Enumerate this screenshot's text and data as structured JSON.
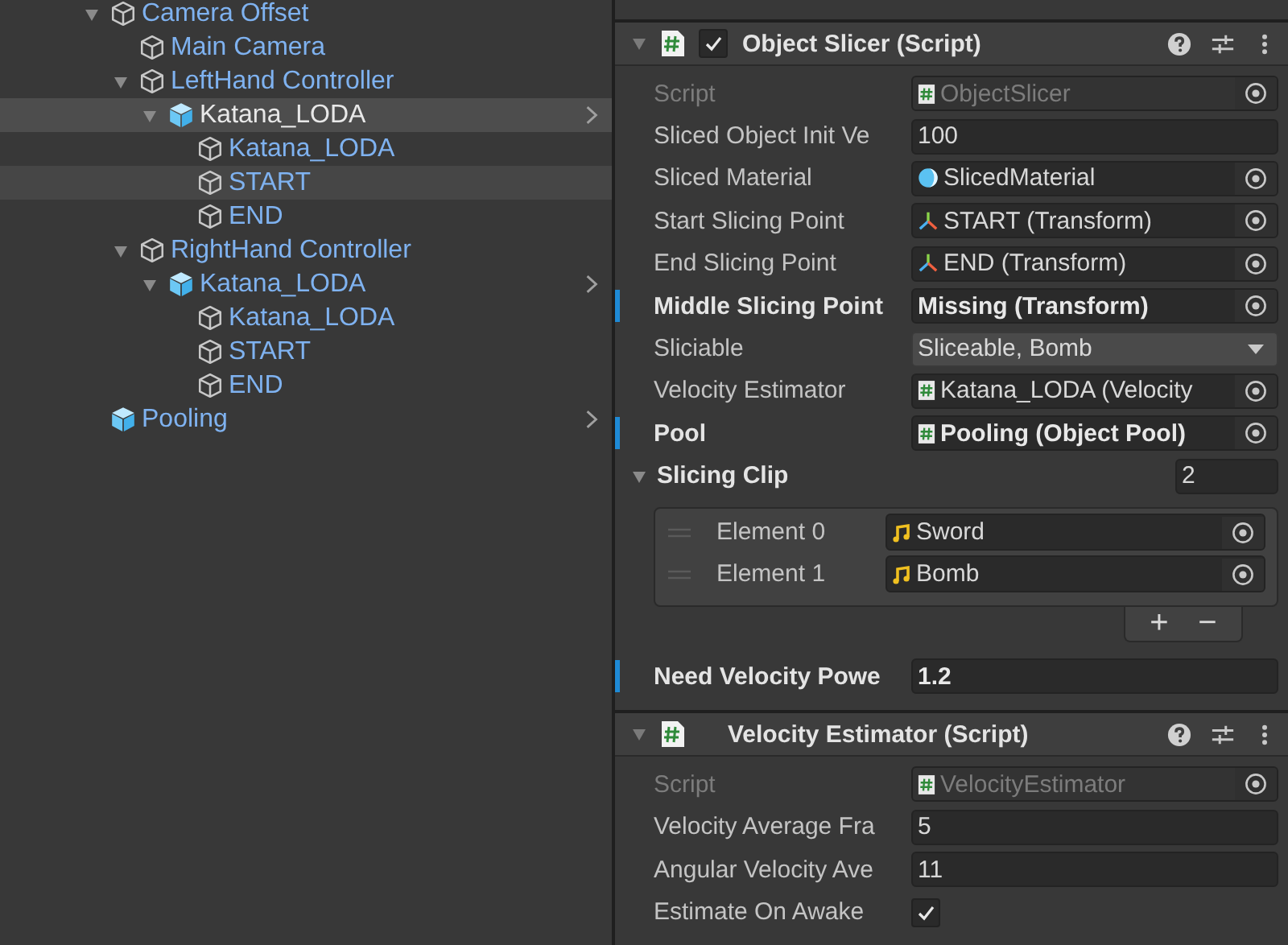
{
  "hierarchy": {
    "items": [
      {
        "name": "Camera Offset",
        "kind": "object",
        "expanded": true,
        "selected": false,
        "highlighted": false,
        "children": [
          {
            "name": "Main Camera",
            "kind": "object",
            "selected": false,
            "highlighted": false
          },
          {
            "name": "LeftHand Controller",
            "kind": "object",
            "expanded": true,
            "selected": false,
            "highlighted": false,
            "children": [
              {
                "name": "Katana_LODA",
                "kind": "prefab",
                "expanded": true,
                "selected": true,
                "highlighted": false,
                "children": [
                  {
                    "name": "Katana_LODA",
                    "kind": "object",
                    "selected": false,
                    "highlighted": false
                  },
                  {
                    "name": "START",
                    "kind": "object",
                    "selected": false,
                    "highlighted": true
                  },
                  {
                    "name": "END",
                    "kind": "object",
                    "selected": false,
                    "highlighted": false
                  }
                ]
              }
            ]
          },
          {
            "name": "RightHand Controller",
            "kind": "object",
            "expanded": true,
            "selected": false,
            "highlighted": false,
            "children": [
              {
                "name": "Katana_LODA",
                "kind": "prefab",
                "expanded": true,
                "selected": false,
                "highlighted": false,
                "children": [
                  {
                    "name": "Katana_LODA",
                    "kind": "object",
                    "selected": false,
                    "highlighted": false
                  },
                  {
                    "name": "START",
                    "kind": "object",
                    "selected": false,
                    "highlighted": false
                  },
                  {
                    "name": "END",
                    "kind": "object",
                    "selected": false,
                    "highlighted": false
                  }
                ]
              }
            ]
          }
        ]
      },
      {
        "name": "Pooling",
        "kind": "prefab",
        "selected": false,
        "highlighted": false
      }
    ]
  },
  "components": [
    {
      "title": "Object Slicer (Script)",
      "has_toggle": true,
      "enabled": true,
      "expanded": true,
      "fields": [
        {
          "kind": "script_ref",
          "label": "Script",
          "value": "ObjectSlicer",
          "disabled": true,
          "overridden": false
        },
        {
          "kind": "number",
          "label": "Sliced Object Init Ve",
          "value": "100",
          "disabled": false,
          "overridden": false
        },
        {
          "kind": "material_ref",
          "label": "Sliced Material",
          "value": "SlicedMaterial",
          "disabled": false,
          "overridden": false
        },
        {
          "kind": "transform_ref",
          "label": "Start Slicing Point",
          "value": "START (Transform)",
          "disabled": false,
          "overridden": false
        },
        {
          "kind": "transform_ref",
          "label": "End Slicing Point",
          "value": "END (Transform)",
          "disabled": false,
          "overridden": false
        },
        {
          "kind": "missing_ref",
          "label": "Middle Slicing Point",
          "value": "Missing (Transform)",
          "disabled": false,
          "overridden": true
        },
        {
          "kind": "dropdown",
          "label": "Sliciable",
          "value": "Sliceable, Bomb",
          "disabled": false,
          "overridden": false
        },
        {
          "kind": "script_ref",
          "label": "Velocity Estimator",
          "value": "Katana_LODA (Velocity",
          "disabled": false,
          "overridden": false
        },
        {
          "kind": "script_ref",
          "label": "Pool",
          "value": "Pooling (Object Pool)",
          "disabled": false,
          "overridden": true
        },
        {
          "kind": "array",
          "label": "Slicing Clip",
          "count": "2",
          "expanded": true,
          "add": "+",
          "remove": "−",
          "elements": [
            {
              "kind": "audio_ref",
              "label": "Element 0",
              "value": "Sword"
            },
            {
              "kind": "audio_ref",
              "label": "Element 1",
              "value": "Bomb"
            }
          ]
        },
        {
          "kind": "number",
          "label": "Need Velocity Powe",
          "value": "1.2",
          "disabled": false,
          "overridden": true
        }
      ]
    },
    {
      "title": "Velocity Estimator (Script)",
      "has_toggle": false,
      "expanded": true,
      "fields": [
        {
          "kind": "script_ref",
          "label": "Script",
          "value": "VelocityEstimator",
          "disabled": true,
          "overridden": false
        },
        {
          "kind": "number",
          "label": "Velocity Average Fra",
          "value": "5",
          "disabled": false,
          "overridden": false
        },
        {
          "kind": "number",
          "label": "Angular Velocity Ave",
          "value": "11",
          "disabled": false,
          "overridden": false
        },
        {
          "kind": "checkbox",
          "label": "Estimate On Awake",
          "checked": true,
          "disabled": false,
          "overridden": false
        }
      ]
    }
  ]
}
